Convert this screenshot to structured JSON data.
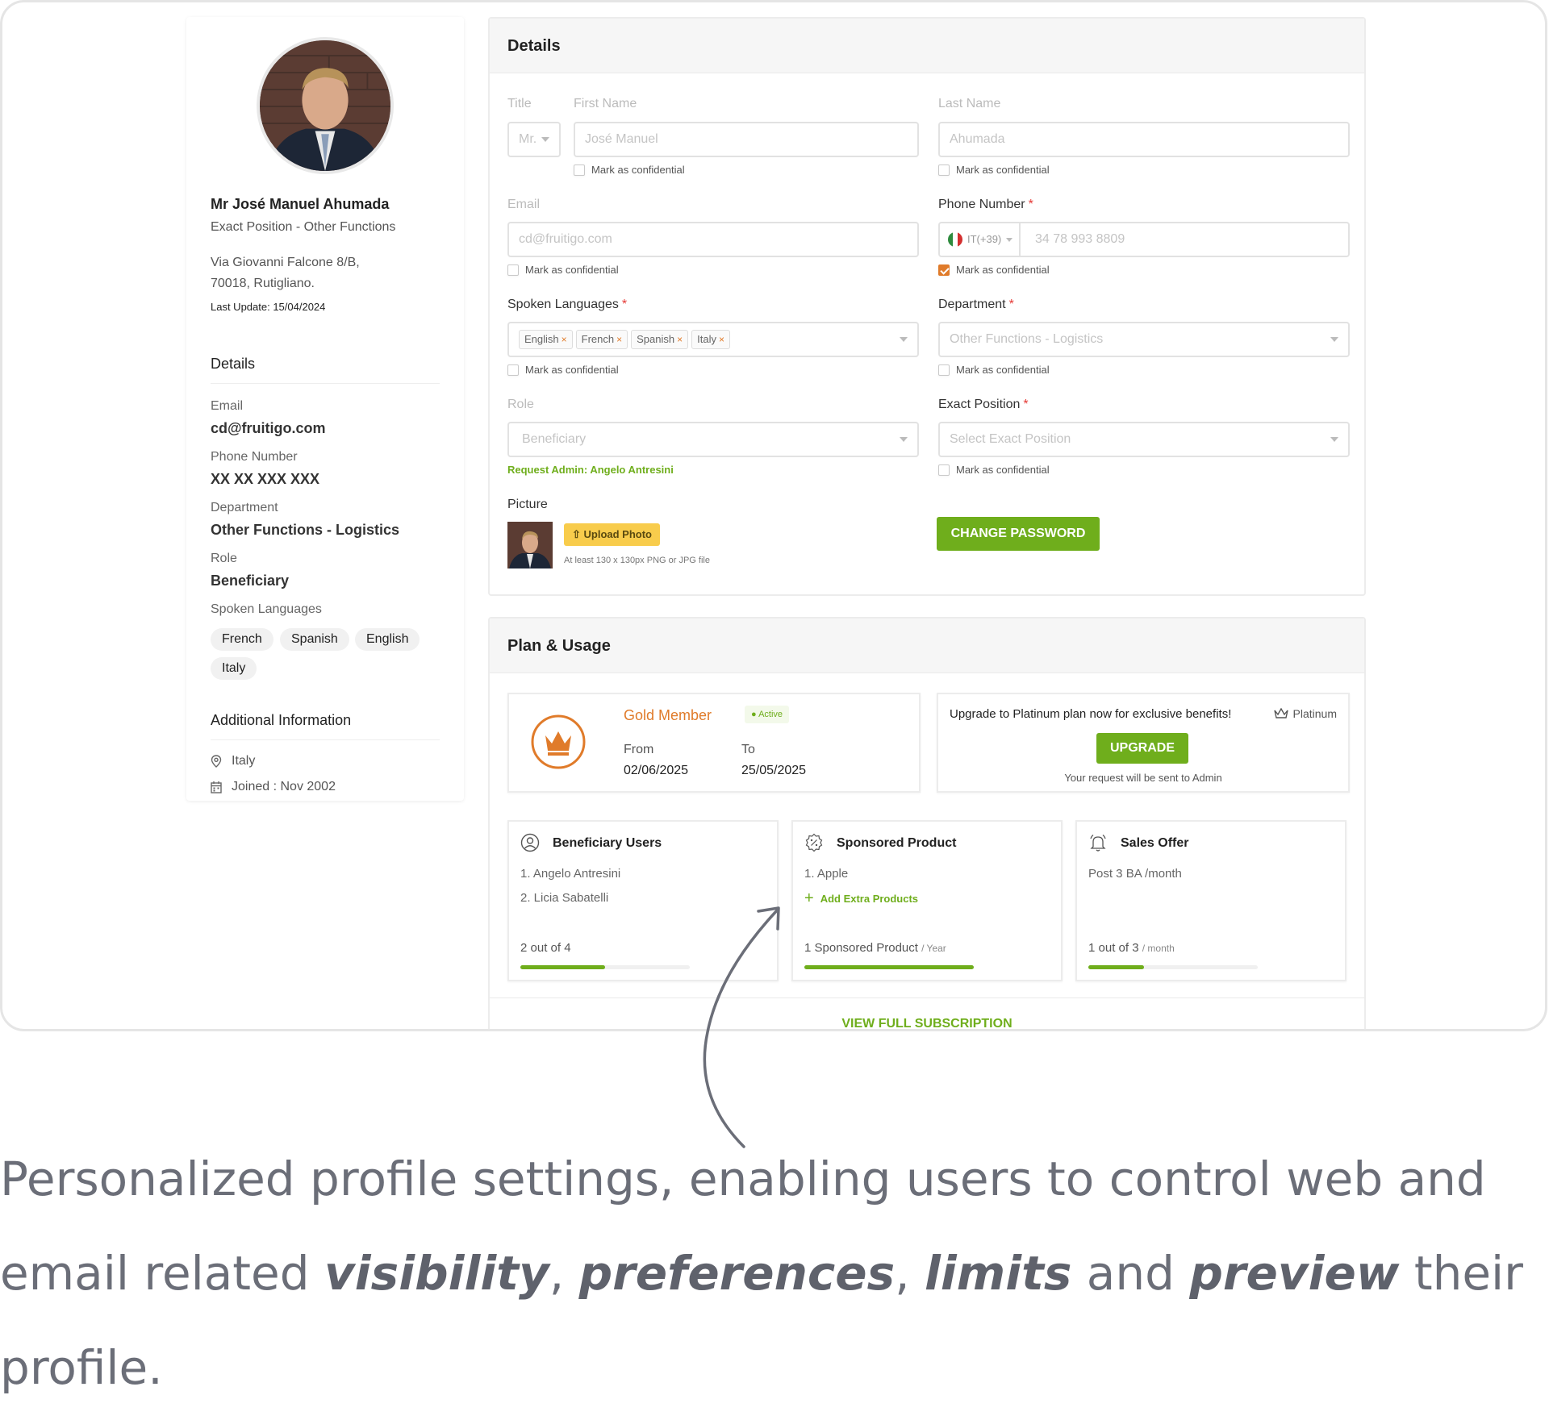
{
  "profile": {
    "name": "Mr José Manuel Ahumada",
    "position": "Exact Position - Other Functions",
    "address_line1": "Via Giovanni Falcone 8/B,",
    "address_line2": "70018, Rutigliano.",
    "last_update": "Last Update: 15/04/2024",
    "details_title": "Details",
    "email_label": "Email",
    "email_value": "cd@fruitigo.com",
    "phone_label": "Phone Number",
    "phone_value": "XX XX XXX XXX",
    "department_label": "Department",
    "department_value": "Other Functions - Logistics",
    "role_label": "Role",
    "role_value": "Beneficiary",
    "languages_label": "Spoken Languages",
    "languages": [
      "French",
      "Spanish",
      "English",
      "Italy"
    ],
    "additional_title": "Additional Information",
    "location": "Italy",
    "joined": "Joined : Nov 2002"
  },
  "details": {
    "title": "Details",
    "title_label": "Title",
    "title_value": "Mr.",
    "first_name_label": "First Name",
    "first_name_value": "José Manuel",
    "last_name_label": "Last Name",
    "last_name_value": "Ahumada",
    "confidential": "Mark as confidential",
    "email_label": "Email",
    "email_value": "cd@fruitigo.com",
    "phone_label": "Phone Number",
    "phone_prefix": "IT(+39)",
    "phone_value": "34 78 993 8809",
    "languages_label": "Spoken Languages",
    "language_tags": [
      "English",
      "French",
      "Spanish",
      "Italy"
    ],
    "tag_remove": "×",
    "department_label": "Department",
    "department_value": "Other Functions - Logistics",
    "role_label": "Role",
    "role_value": "Beneficiary",
    "request_admin": "Request Admin: Angelo Antresini",
    "exact_position_label": "Exact Position",
    "exact_position_placeholder": "Select Exact Position",
    "picture_label": "Picture",
    "upload_label": "Upload Photo",
    "upload_hint": "At least  130 x 130px PNG or JPG file",
    "change_password": "CHANGE PASSWORD",
    "required_mark": "*"
  },
  "plan": {
    "title": "Plan & Usage",
    "member_label": "Gold Member",
    "status": "Active",
    "from_label": "From",
    "from_value": "02/06/2025",
    "to_label": "To",
    "to_value": "25/05/2025",
    "upgrade_text": "Upgrade to Platinum plan now for exclusive benefits!",
    "platinum_label": "Platinum",
    "upgrade_button": "UPGRADE",
    "upgrade_note": "Your request will be sent to Admin",
    "beneficiary_title": "Beneficiary Users",
    "beneficiary_items": [
      "1. Angelo Antresini",
      "2.  Licia Sabatelli"
    ],
    "beneficiary_usage": "2 out of 4",
    "beneficiary_progress": 0.5,
    "sponsored_title": "Sponsored Product",
    "sponsored_items": [
      "1. Apple"
    ],
    "add_extra": "Add Extra Products",
    "sponsored_usage": "1 Sponsored Product",
    "sponsored_unit": "/ Year",
    "sponsored_progress": 1.0,
    "sales_title": "Sales Offer",
    "sales_text": "Post 3 BA /month",
    "sales_usage": "1 out of 3",
    "sales_unit": "/ month",
    "sales_progress": 0.33,
    "view_full": "VIEW FULL SUBSCRIPTION"
  },
  "caption": {
    "line1": "Personalized profile settings, enabling users to control web and",
    "line2_start": "email related ",
    "w_visibility": "visibility",
    "comma1": ", ",
    "w_preferences": "preferences",
    "comma2": ", ",
    "w_limits": "limits",
    "and": " and ",
    "w_preview": "preview",
    "their": " their",
    "line3": "profile."
  },
  "colors": {
    "accent_green": "#6fae1c",
    "accent_orange": "#e07b2a",
    "upload_yellow": "#f8cc4c",
    "required_red": "#e53935"
  }
}
